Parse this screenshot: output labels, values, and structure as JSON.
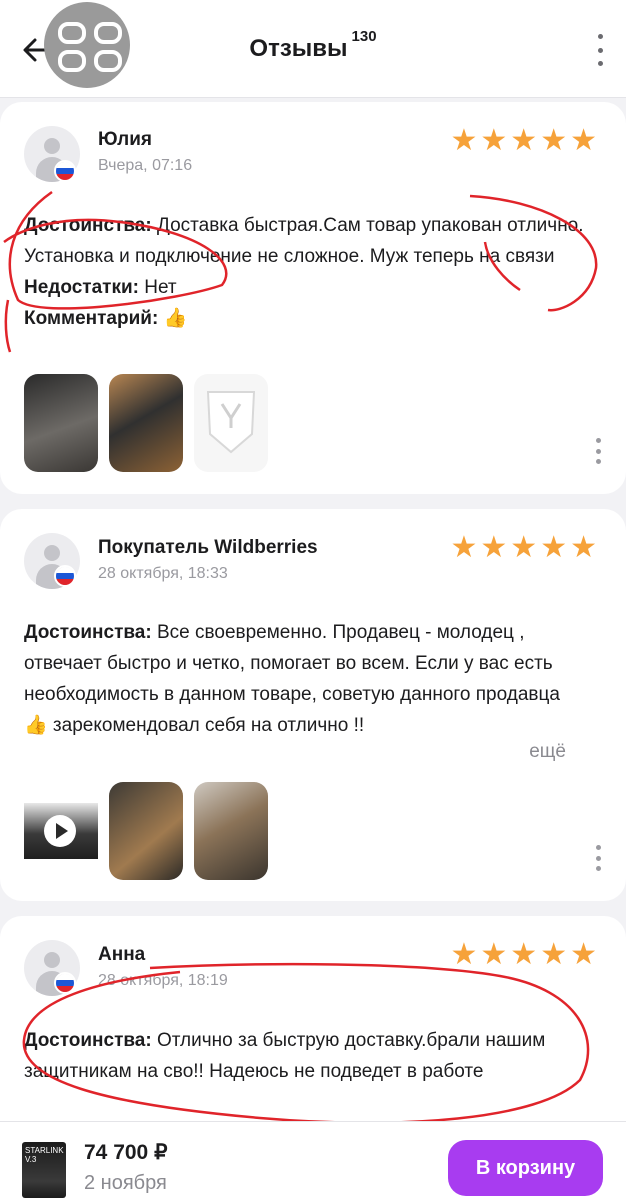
{
  "header": {
    "title": "Отзывы",
    "count": "130",
    "back_icon": "arrow-left-icon",
    "grid_icon": "grid-icon",
    "menu_icon": "more-vertical-icon"
  },
  "reviews": [
    {
      "author": "Юлия",
      "date": "Вчера, 07:16",
      "rating": 5,
      "stars": "★★★★★",
      "pros_label": "Достоинства:",
      "pros_text": "Доставка быстрая.Сам товар упакован отлично. Установка и подключение не сложное. Муж теперь на связи",
      "cons_label": "Недостатки:",
      "cons_text": "Нет",
      "comment_label": "Комментарий:",
      "comment_text": "👍"
    },
    {
      "author": "Покупатель Wildberries",
      "date": "28 октября, 18:33",
      "rating": 5,
      "stars": "★★★★★",
      "pros_label": "Достоинства:",
      "pros_text": "Все своевременно. Продавец - молодец , отвечает быстро и четко, помогает во всем. Если у вас есть необходимость в данном товаре, советую данного продавца 👍 зарекомендовал себя на отлично !!",
      "more_label": "ещё"
    },
    {
      "author": "Анна",
      "date": "28 октября, 18:19",
      "rating": 5,
      "stars": "★★★★★",
      "pros_label": "Достоинства:",
      "pros_text": "Отлично за быструю доставку.брали нашим защитникам на сво!! Надеюсь не подведет в работе"
    }
  ],
  "bottom_bar": {
    "product_thumb_text": "STARLINK V.3",
    "price": "74 700 ₽",
    "delivery": "2 ноября",
    "cart_button": "В корзину"
  },
  "colors": {
    "accent": "#a83cf0",
    "stars": "#f6a23a",
    "annotation": "#e0242a"
  }
}
